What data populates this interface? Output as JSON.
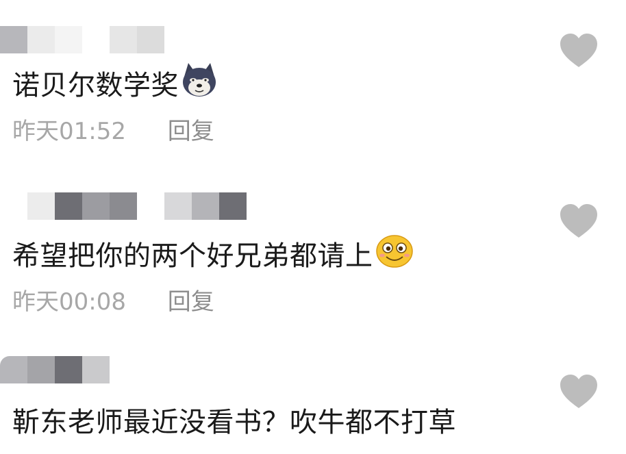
{
  "comments": [
    {
      "text": "诺贝尔数学奖",
      "emoji": "husky-doge-emoji",
      "time": "昨天01:52",
      "reply_label": "回复",
      "like_icon": "heart-icon"
    },
    {
      "text": "希望把你的两个好兄弟都请上",
      "emoji": "smiling-face-emoji",
      "time": "昨天00:08",
      "reply_label": "回复",
      "like_icon": "heart-icon"
    },
    {
      "text": "靳东老师最近没看书？吹牛都不打草",
      "like_icon": "heart-icon"
    }
  ],
  "colors": {
    "heart": "#bcbcbc",
    "meta_text": "#a7a7a7",
    "mosaic": [
      "#c8c8c8",
      "#aeaeb2",
      "#8a8a8e",
      "#dcdcdc",
      "#6f6f74"
    ]
  }
}
